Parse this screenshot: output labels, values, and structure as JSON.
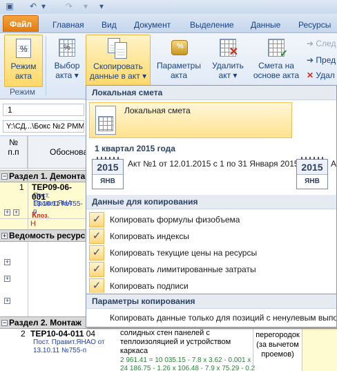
{
  "quick_access": {
    "items": [
      "save-icon",
      "undo-icon",
      "redo-icon",
      "customize-icon"
    ]
  },
  "tabs": [
    {
      "label": "Файл"
    },
    {
      "label": "Главная"
    },
    {
      "label": "Вид"
    },
    {
      "label": "Документ"
    },
    {
      "label": "Выделение"
    },
    {
      "label": "Данные"
    },
    {
      "label": "Ресурсы"
    }
  ],
  "ribbon": {
    "group_label": "Режим",
    "mode_act": "Режим акта",
    "mode_act_line1": "Режим",
    "mode_act_line2": "акта",
    "select_act_line1": "Выбор",
    "select_act_line2": "акта",
    "copy_line1": "Скопировать",
    "copy_line2": "данные в акт",
    "params_line1": "Параметры",
    "params_line2": "акта",
    "delete_line1": "Удалить",
    "delete_line2": "акт",
    "estimate_line1": "Смета на",
    "estimate_line2": "основе акта",
    "small_next": "След",
    "small_prev": "Пред",
    "small_delete": "Удал"
  },
  "sheet": {
    "input_value": "1",
    "path_value": "Y:\\СД...\\Бокс №2 РММ",
    "col_no": "№",
    "col_pp": "п.п",
    "col_basis": "Обосновa",
    "section1": "Раздел 1. Демонта",
    "row1": {
      "num": "1",
      "code": "ТЕР09-06-001",
      "desc1": "Пост. Правит.ЯНА",
      "desc2": "13.10.11 №755-п",
      "k": "К",
      "k_sub": "поз.",
      "n": "Н"
    },
    "section_res": "Ведомость ресурс",
    "section2": "Раздел 2. Монтаж",
    "row2": {
      "num": "2",
      "code": "ТЕР10-04-011",
      "code_suffix": "04",
      "desc1": "Пост. Правит.ЯНАО от",
      "desc2": "13.10.11 №755-п",
      "text1": "солидных стен панелей с",
      "text2": "теплоизоляцией и устройством",
      "text3": "каркаса",
      "formula1": "2 961.41 = 10 035.15 - 7.8 x 3.62 - 0.001 x",
      "formula2": "24 186.75 - 1.26 x 106.48 - 7.9 x 75.29 - 0.2",
      "qty1": "перегородок",
      "qty2": "(за вычетом",
      "qty3": "проемов)"
    }
  },
  "dropdown": {
    "local_estimate_header": "Локальная смета",
    "local_estimate_item": "Локальная смета",
    "quarter_header": "1 квартал 2015 года",
    "act_item": "Акт №1 от 12.01.2015 с 1 по 31 Января 2015г.",
    "act_item2": "А",
    "calendar_year": "2015",
    "calendar_month": "ЯНВ",
    "copy_data_header": "Данные для копирования",
    "options": [
      {
        "label": "Копировать формулы физобъема",
        "checked": true
      },
      {
        "label": "Копировать индексы",
        "checked": true
      },
      {
        "label": "Копировать текущие цены на ресурсы",
        "checked": true
      },
      {
        "label": "Копировать лимитированные затраты",
        "checked": true
      },
      {
        "label": "Копировать подписи",
        "checked": true
      }
    ],
    "copy_params_header": "Параметры копирования",
    "param_option": "Копировать данные только для позиций с ненулевым выпо"
  },
  "colors": {
    "file_tab": "#e37b11",
    "highlight": "#ffd866",
    "ribbon_bg": "#dce7f5"
  }
}
